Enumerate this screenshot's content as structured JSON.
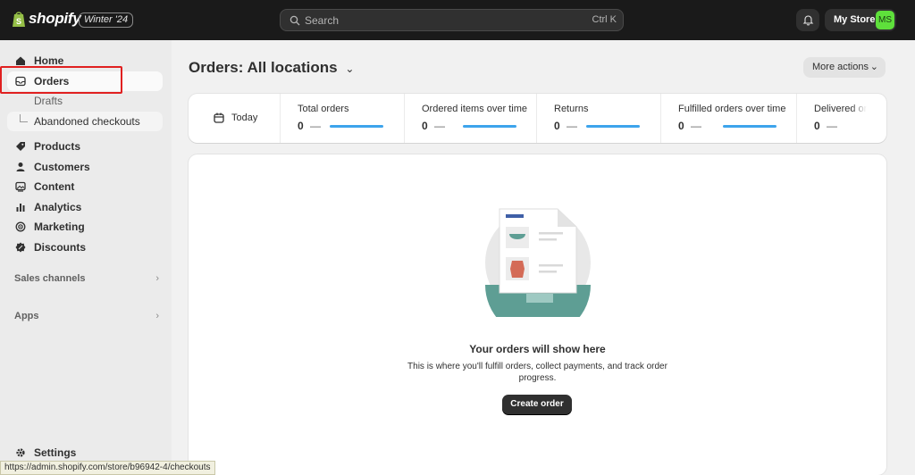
{
  "topbar": {
    "brand": "shopify",
    "edition_badge": "Winter '24",
    "search_placeholder": "Search",
    "search_shortcut": "Ctrl K",
    "store_name": "My Store",
    "avatar_initials": "MS",
    "avatar_color": "#5ee03b"
  },
  "sidebar": {
    "items": [
      {
        "label": "Home",
        "icon": "home-icon"
      },
      {
        "label": "Orders",
        "icon": "inbox-icon",
        "active": true
      },
      {
        "label": "Drafts"
      },
      {
        "label": "Abandoned checkouts"
      },
      {
        "label": "Products",
        "icon": "tag-icon"
      },
      {
        "label": "Customers",
        "icon": "person-icon"
      },
      {
        "label": "Content",
        "icon": "image-icon"
      },
      {
        "label": "Analytics",
        "icon": "bar-chart-icon"
      },
      {
        "label": "Marketing",
        "icon": "target-icon"
      },
      {
        "label": "Discounts",
        "icon": "discount-icon"
      }
    ],
    "sections": {
      "sales_channels": "Sales channels",
      "apps": "Apps"
    },
    "settings_label": "Settings"
  },
  "main": {
    "title": "Orders:",
    "location": "All locations",
    "more_actions": "More actions",
    "date_filter": "Today",
    "metrics": [
      {
        "label": "Total orders",
        "value": "0",
        "dash": "—"
      },
      {
        "label": "Ordered items over time",
        "value": "0",
        "dash": "—"
      },
      {
        "label": "Returns",
        "value": "0",
        "dash": "—"
      },
      {
        "label": "Fulfilled orders over time",
        "value": "0",
        "dash": "—"
      },
      {
        "label": "Delivered or",
        "value": "0",
        "dash": "—"
      }
    ],
    "empty_state": {
      "title": "Your orders will show here",
      "description": "This is where you'll fulfill orders, collect payments, and track order progress.",
      "button": "Create order"
    }
  },
  "status_bar": {
    "url": "https://admin.shopify.com/store/b96942-4/checkouts"
  },
  "colors": {
    "accent_green": "#5ee03b",
    "sparkline_blue": "#1b94e9",
    "highlight_red": "#e02020",
    "topbar_bg": "#1a1a1a"
  }
}
